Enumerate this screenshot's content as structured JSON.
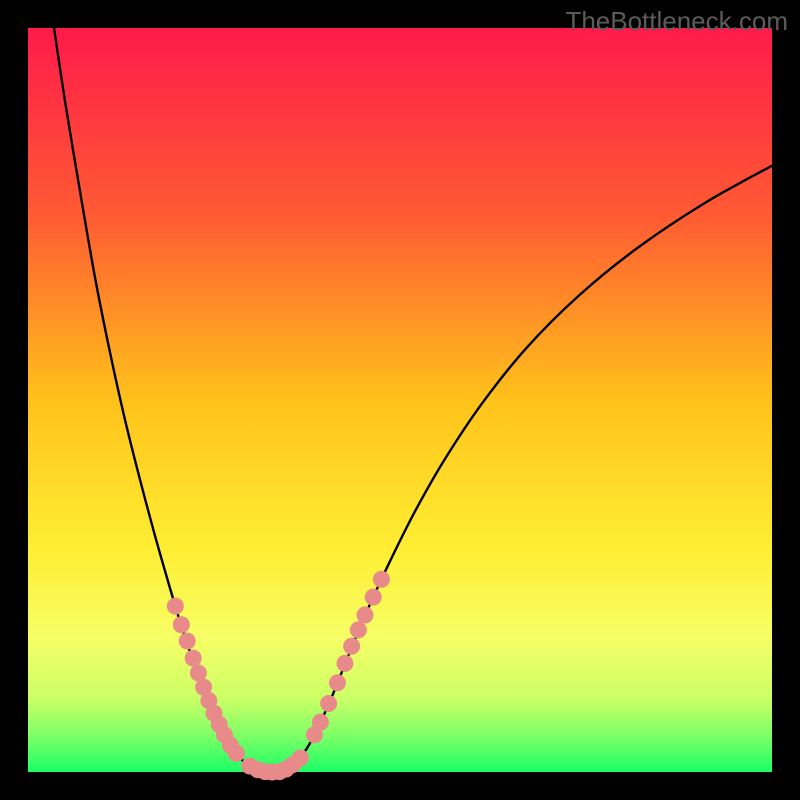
{
  "watermark": "TheBottleneck.com",
  "chart_data": {
    "type": "line",
    "x_range": [
      0,
      100
    ],
    "y_range": [
      0,
      100
    ],
    "title": "",
    "xlabel": "",
    "ylabel": "",
    "legend": [],
    "background_gradient_stops": [
      {
        "offset": 0.0,
        "color": "#ff1a4b"
      },
      {
        "offset": 0.25,
        "color": "#ff5a33"
      },
      {
        "offset": 0.5,
        "color": "#ffc21a"
      },
      {
        "offset": 0.7,
        "color": "#ffee33"
      },
      {
        "offset": 0.82,
        "color": "#f6ff66"
      },
      {
        "offset": 0.9,
        "color": "#ccff66"
      },
      {
        "offset": 0.95,
        "color": "#80ff66"
      },
      {
        "offset": 1.0,
        "color": "#1aff66"
      }
    ],
    "series": [
      {
        "name": "left-branch",
        "type": "line",
        "color": "#000000",
        "points": [
          {
            "x": 3.5,
            "y": 100.0
          },
          {
            "x": 5.0,
            "y": 90.0
          },
          {
            "x": 7.0,
            "y": 78.0
          },
          {
            "x": 9.0,
            "y": 66.5
          },
          {
            "x": 11.0,
            "y": 56.5
          },
          {
            "x": 13.0,
            "y": 47.5
          },
          {
            "x": 15.0,
            "y": 39.5
          },
          {
            "x": 17.0,
            "y": 32.0
          },
          {
            "x": 19.0,
            "y": 25.0
          },
          {
            "x": 20.5,
            "y": 20.0
          },
          {
            "x": 22.0,
            "y": 15.5
          },
          {
            "x": 23.5,
            "y": 11.5
          },
          {
            "x": 25.0,
            "y": 8.0
          },
          {
            "x": 26.5,
            "y": 5.0
          },
          {
            "x": 28.0,
            "y": 2.5
          },
          {
            "x": 29.5,
            "y": 1.0
          },
          {
            "x": 31.0,
            "y": 0.3
          },
          {
            "x": 32.8,
            "y": 0.0
          }
        ]
      },
      {
        "name": "right-branch",
        "type": "line",
        "color": "#000000",
        "points": [
          {
            "x": 32.8,
            "y": 0.0
          },
          {
            "x": 34.5,
            "y": 0.2
          },
          {
            "x": 36.0,
            "y": 1.3
          },
          {
            "x": 37.5,
            "y": 3.2
          },
          {
            "x": 39.0,
            "y": 6.0
          },
          {
            "x": 41.0,
            "y": 10.5
          },
          {
            "x": 43.0,
            "y": 15.5
          },
          {
            "x": 45.5,
            "y": 21.5
          },
          {
            "x": 48.5,
            "y": 28.0
          },
          {
            "x": 52.0,
            "y": 35.0
          },
          {
            "x": 56.0,
            "y": 42.0
          },
          {
            "x": 61.0,
            "y": 49.5
          },
          {
            "x": 67.0,
            "y": 57.0
          },
          {
            "x": 74.0,
            "y": 64.0
          },
          {
            "x": 82.0,
            "y": 70.5
          },
          {
            "x": 91.0,
            "y": 76.5
          },
          {
            "x": 100.0,
            "y": 81.5
          }
        ]
      },
      {
        "name": "left-markers",
        "type": "scatter",
        "color": "#e98a8a",
        "points": [
          {
            "x": 19.8,
            "y": 22.3
          },
          {
            "x": 20.6,
            "y": 19.8
          },
          {
            "x": 21.4,
            "y": 17.6
          },
          {
            "x": 22.2,
            "y": 15.3
          },
          {
            "x": 22.9,
            "y": 13.3
          },
          {
            "x": 23.6,
            "y": 11.4
          },
          {
            "x": 24.3,
            "y": 9.6
          },
          {
            "x": 25.0,
            "y": 7.9
          },
          {
            "x": 25.7,
            "y": 6.4
          },
          {
            "x": 26.4,
            "y": 5.0
          },
          {
            "x": 27.2,
            "y": 3.6
          },
          {
            "x": 28.0,
            "y": 2.5
          },
          {
            "x": 29.8,
            "y": 0.8
          },
          {
            "x": 30.9,
            "y": 0.3
          },
          {
            "x": 31.9,
            "y": 0.05
          },
          {
            "x": 32.8,
            "y": 0.0
          }
        ]
      },
      {
        "name": "right-markers",
        "type": "scatter",
        "color": "#e98a8a",
        "points": [
          {
            "x": 33.8,
            "y": 0.05
          },
          {
            "x": 34.7,
            "y": 0.4
          },
          {
            "x": 35.6,
            "y": 1.0
          },
          {
            "x": 36.6,
            "y": 1.9
          },
          {
            "x": 38.5,
            "y": 5.0
          },
          {
            "x": 39.3,
            "y": 6.7
          },
          {
            "x": 40.4,
            "y": 9.2
          },
          {
            "x": 41.6,
            "y": 12.0
          },
          {
            "x": 42.6,
            "y": 14.6
          },
          {
            "x": 43.5,
            "y": 16.9
          },
          {
            "x": 44.4,
            "y": 19.1
          },
          {
            "x": 45.3,
            "y": 21.1
          },
          {
            "x": 46.4,
            "y": 23.5
          },
          {
            "x": 47.5,
            "y": 25.9
          }
        ]
      }
    ],
    "border_thickness_pct": 3.5
  }
}
